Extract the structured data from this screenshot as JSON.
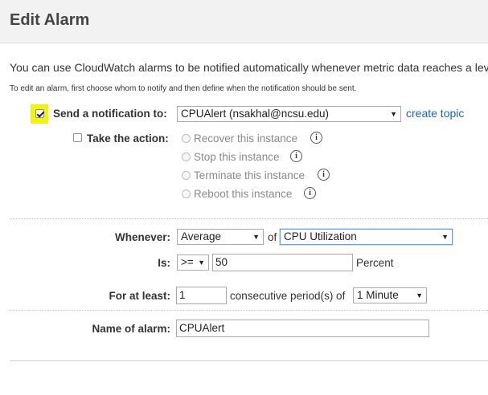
{
  "header": {
    "title": "Edit Alarm"
  },
  "intro": {
    "text": "You can use CloudWatch alarms to be notified automatically whenever metric data reaches a lev",
    "sub": "To edit an alarm, first choose whom to notify and then define when the notification should be sent."
  },
  "notify": {
    "label": "Send a notification to:",
    "checked": true,
    "selected": "CPUAlert (nsakhal@ncsu.edu)",
    "create_topic": "create topic"
  },
  "action": {
    "label": "Take the action:",
    "checked": false,
    "options": [
      {
        "label": "Recover this instance"
      },
      {
        "label": "Stop this instance"
      },
      {
        "label": "Terminate this instance"
      },
      {
        "label": "Reboot this instance"
      }
    ]
  },
  "condition": {
    "whenever_label": "Whenever:",
    "statistic": "Average",
    "of_label": "of",
    "metric": "CPU Utilization",
    "is_label": "Is:",
    "operator": ">=",
    "threshold": "50",
    "unit": "Percent",
    "for_label": "For at least:",
    "periods": "1",
    "consecutive_label": "consecutive period(s) of",
    "period": "1 Minute"
  },
  "name": {
    "label": "Name of alarm:",
    "value": "CPUAlert"
  },
  "icons": {
    "info": "i",
    "dropdown": "▼"
  }
}
